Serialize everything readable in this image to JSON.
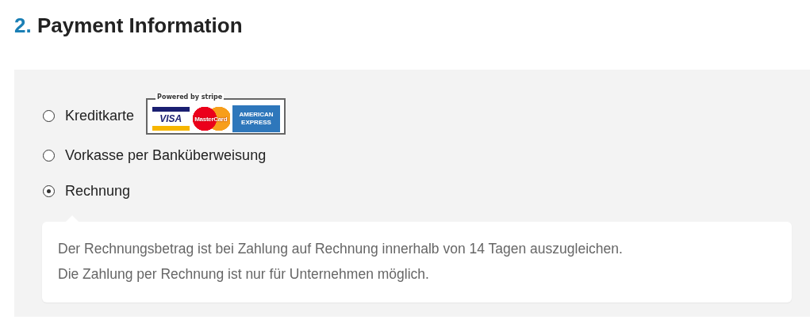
{
  "heading": {
    "number": "2.",
    "title": "Payment Information"
  },
  "options": [
    {
      "label": "Kreditkarte",
      "selected": false,
      "badge": {
        "caption": "Powered by stripe",
        "cards": [
          "VISA",
          "MasterCard",
          "AMERICAN EXPRESS"
        ]
      }
    },
    {
      "label": "Vorkasse per Banküberweisung",
      "selected": false
    },
    {
      "label": "Rechnung",
      "selected": true,
      "notes": [
        "Der Rechnungsbetrag ist bei Zahlung auf Rechnung innerhalb von 14 Tagen auszugleichen.",
        "Die Zahlung per Rechnung ist nur für Unternehmen möglich."
      ]
    }
  ]
}
